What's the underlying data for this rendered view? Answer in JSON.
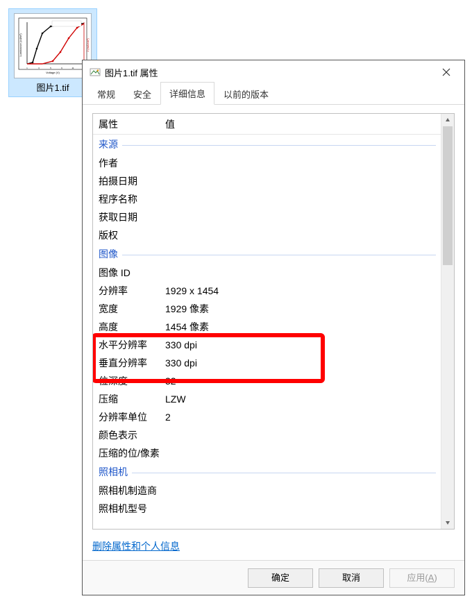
{
  "desktop": {
    "file": {
      "label": "图片1.tif"
    }
  },
  "dialog": {
    "title": "图片1.tif 属性",
    "tabs": {
      "general": "常规",
      "security": "安全",
      "details": "详细信息",
      "previous": "以前的版本"
    },
    "columns": {
      "property": "属性",
      "value": "值"
    },
    "groups": {
      "source": {
        "label": "来源",
        "items": {
          "author": {
            "name": "作者",
            "value": ""
          },
          "shot_date": {
            "name": "拍摄日期",
            "value": ""
          },
          "program": {
            "name": "程序名称",
            "value": ""
          },
          "acquired": {
            "name": "获取日期",
            "value": ""
          },
          "copyright": {
            "name": "版权",
            "value": ""
          }
        }
      },
      "image": {
        "label": "图像",
        "items": {
          "image_id": {
            "name": "图像 ID",
            "value": ""
          },
          "resolution": {
            "name": "分辨率",
            "value": "1929 x 1454"
          },
          "width": {
            "name": "宽度",
            "value": "1929 像素"
          },
          "height": {
            "name": "高度",
            "value": "1454 像素"
          },
          "hres": {
            "name": "水平分辨率",
            "value": "330 dpi"
          },
          "vres": {
            "name": "垂直分辨率",
            "value": "330 dpi"
          },
          "bitdepth": {
            "name": "位深度",
            "value": "32"
          },
          "compression": {
            "name": "压缩",
            "value": "LZW"
          },
          "resunit": {
            "name": "分辨率单位",
            "value": "2"
          },
          "colorrep": {
            "name": "颜色表示",
            "value": ""
          },
          "bpp": {
            "name": "压缩的位/像素",
            "value": ""
          }
        }
      },
      "camera": {
        "label": "照相机",
        "items": {
          "maker": {
            "name": "照相机制造商",
            "value": ""
          },
          "model": {
            "name": "照相机型号",
            "value": ""
          }
        }
      }
    },
    "remove_link": "删除属性和个人信息",
    "buttons": {
      "ok": "确定",
      "cancel": "取消",
      "apply": "应用",
      "apply_accel": "A"
    }
  }
}
